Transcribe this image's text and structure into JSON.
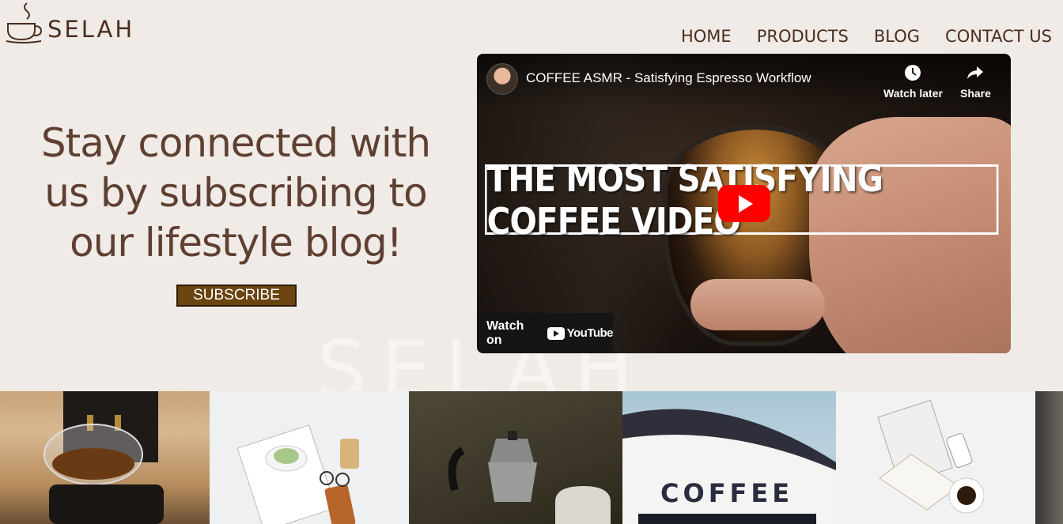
{
  "brand": {
    "name": "SELAH",
    "logo_icon": "coffee-cup-icon"
  },
  "nav": {
    "items": [
      "HOME",
      "PRODUCTS",
      "BLOG",
      "CONTACT US"
    ]
  },
  "hero": {
    "headline": "Stay connected with us by subscribing to our lifestyle blog!",
    "subscribe_label": "SUBSCRIBE",
    "watermark": "SELAH"
  },
  "video": {
    "title": "COFFEE ASMR - Satisfying Espresso Workflow",
    "watch_later_label": "Watch later",
    "share_label": "Share",
    "banner_text": "THE MOST SATISFYING COFFEE VIDEO",
    "watch_on_label": "Watch on",
    "youtube_label": "YouTube"
  },
  "gallery": {
    "images": [
      {
        "name": "espresso-machine-cup"
      },
      {
        "name": "magazine-matcha-flatlay"
      },
      {
        "name": "moka-pot"
      },
      {
        "name": "coffee-shop-sign",
        "text": "COFFEE"
      },
      {
        "name": "cereal-magazine-coffee"
      },
      {
        "name": "partial-image"
      }
    ]
  },
  "colors": {
    "background": "#f0ebe6",
    "text": "#5e4033",
    "button": "#6b4410",
    "youtube_red": "#ff0000"
  }
}
